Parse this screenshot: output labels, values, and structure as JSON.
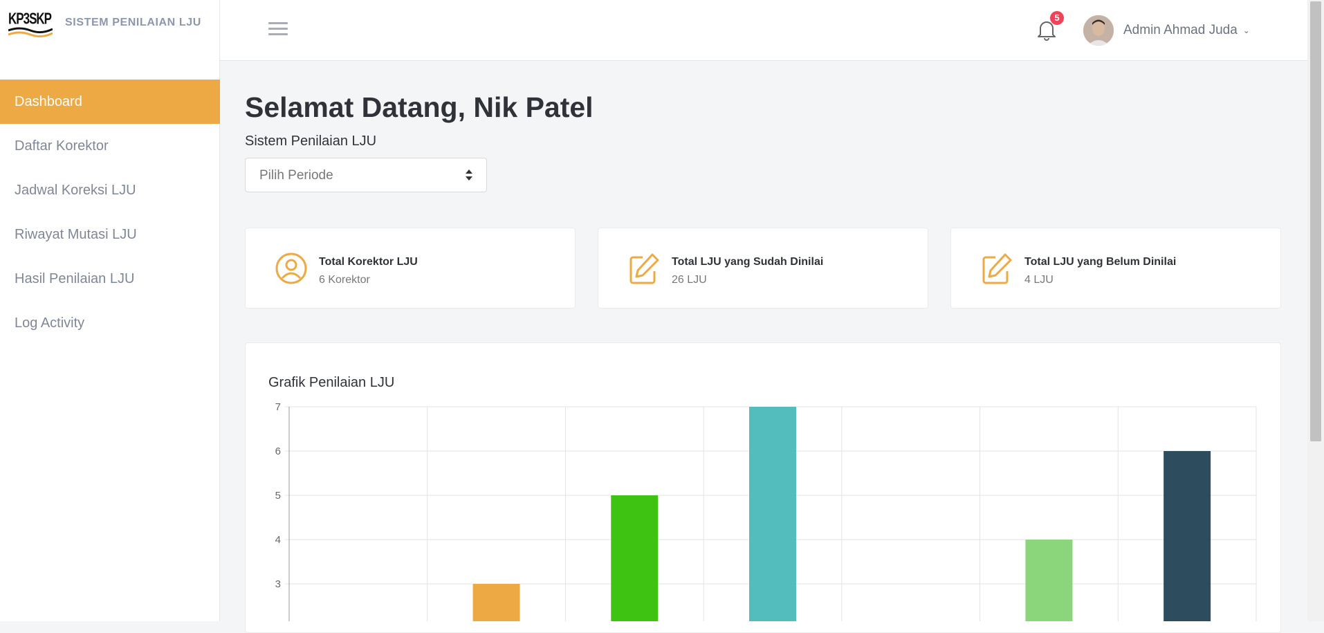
{
  "brand": {
    "logo_text": "KP3SKP",
    "title": "SISTEM PENILAIAN LJU"
  },
  "sidebar": {
    "items": [
      {
        "label": "Dashboard"
      },
      {
        "label": "Daftar Korektor"
      },
      {
        "label": "Jadwal Koreksi LJU"
      },
      {
        "label": "Riwayat Mutasi LJU"
      },
      {
        "label": "Hasil Penilaian LJU"
      },
      {
        "label": "Log Activity"
      }
    ],
    "active_color": "#eda943"
  },
  "header": {
    "notification_count": "5",
    "user_name": "Admin Ahmad Juda",
    "menu_icon": "hamburger-icon",
    "bell_icon": "bell-icon"
  },
  "main": {
    "welcome": "Selamat Datang, Nik Patel",
    "subtitle": "Sistem Penilaian LJU",
    "period_select": {
      "value": "Pilih Periode"
    }
  },
  "cards": [
    {
      "title": "Total Korektor LJU",
      "value": "6 Korektor",
      "icon": "user-circle-icon"
    },
    {
      "title": "Total LJU yang Sudah Dinilai",
      "value": "26 LJU",
      "icon": "edit-icon"
    },
    {
      "title": "Total LJU yang Belum Dinilai",
      "value": "4 LJU",
      "icon": "edit-icon"
    }
  ],
  "chart_title": "Grafik Penilaian LJU",
  "chart_data": {
    "type": "bar",
    "title": "Grafik Penilaian LJU",
    "categories": [
      "",
      "",
      "",
      "",
      "",
      "",
      ""
    ],
    "values": [
      null,
      3,
      5,
      7,
      null,
      4,
      6
    ],
    "colors": [
      "#eda943",
      "#eda943",
      "#3ec313",
      "#53bcbc",
      "#53bcbc",
      "#8bd57a",
      "#2d4d5e"
    ],
    "y_ticks": [
      "7",
      "6",
      "5",
      "4",
      "3"
    ],
    "ylim": [
      2,
      7
    ],
    "grid": true
  },
  "accent_color": "#eda943"
}
